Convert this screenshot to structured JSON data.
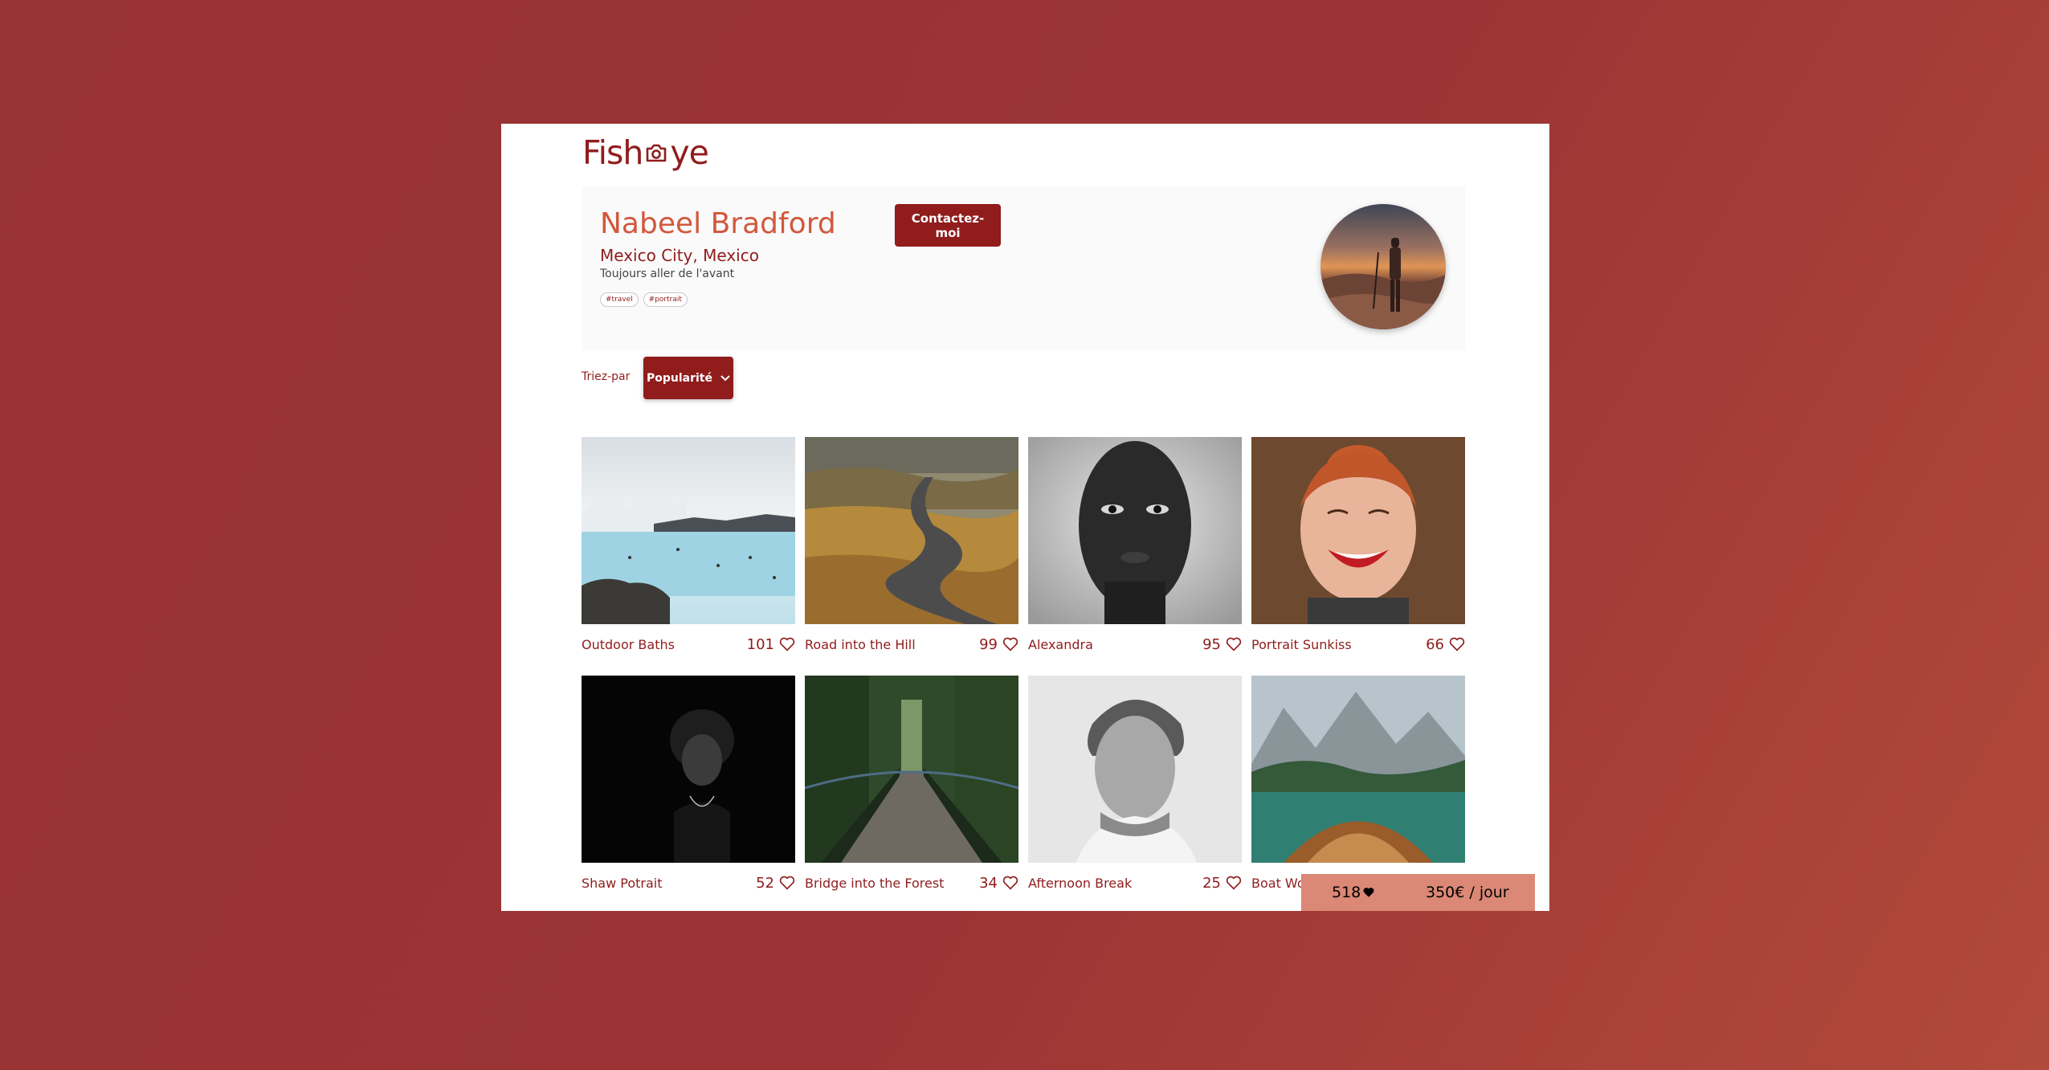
{
  "app": {
    "logo_prefix": "Fish",
    "logo_suffix": "ye"
  },
  "photographer": {
    "name": "Nabeel Bradford",
    "location": "Mexico City, Mexico",
    "tagline": "Toujours aller de l'avant",
    "tags": [
      "#travel",
      "#portrait"
    ],
    "contact_label": "Contactez-moi"
  },
  "sort": {
    "label": "Triez-par",
    "selected": "Popularité"
  },
  "media": [
    {
      "title": "Outdoor Baths",
      "likes": "101"
    },
    {
      "title": "Road into the Hill",
      "likes": "99"
    },
    {
      "title": "Alexandra",
      "likes": "95"
    },
    {
      "title": "Portrait Sunkiss",
      "likes": "66"
    },
    {
      "title": "Shaw Potrait",
      "likes": "52"
    },
    {
      "title": "Bridge into the Forest",
      "likes": "34"
    },
    {
      "title": "Afternoon Break",
      "likes": "25"
    },
    {
      "title": "Boat Wonderland",
      "likes": ""
    }
  ],
  "stats": {
    "total_likes": "518",
    "price": "350€ / jour"
  },
  "colors": {
    "primary": "#901c1c",
    "secondary": "#d3573c",
    "stats_bg": "#db8876",
    "page_bg": "#993234"
  }
}
